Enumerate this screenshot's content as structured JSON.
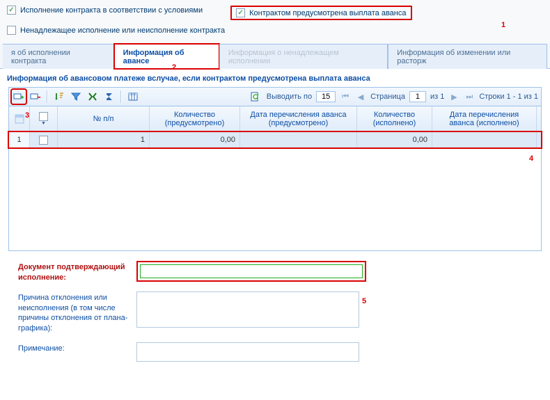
{
  "top": {
    "cb1_label": "Исполнение контракта в соответствии с условиями",
    "cb1_checked": true,
    "cb2_label": "Контрактом предусмотрена выплата аванса",
    "cb2_checked": true,
    "cb3_label": "Ненадлежащее исполнение или неисполнение контракта",
    "cb3_checked": false
  },
  "annotations": {
    "a1": "1",
    "a2": "2",
    "a3": "3",
    "a4": "4",
    "a5": "5"
  },
  "tabs": {
    "t0": "я об исполнении контракта",
    "t1": "Информация об авансе",
    "t2": "Информация о ненадлежащем исполнении",
    "t3": "Информация об изменении или расторж"
  },
  "section_title": "Информация об авансовом платеже вслучае, если контрактом предусмотрена выплата аванса",
  "paging": {
    "show_label": "Выводить по",
    "per_page": "15",
    "page_label": "Страница",
    "current": "1",
    "of": "из 1",
    "rows_text": "Строки 1 - 1 из 1"
  },
  "columns": {
    "c2": "№ п/п",
    "c3": "Количество (предусмотрено)",
    "c4": "Дата перечисления аванса (предусмотрено)",
    "c5": "Количество (исполнено)",
    "c6": "Дата перечисления аванса (исполнено)"
  },
  "row": {
    "idx": "1",
    "no": "1",
    "qty_plan": "0,00",
    "date_plan": "",
    "qty_fact": "0,00",
    "date_fact": ""
  },
  "form": {
    "doc_label": "Документ подтверждающий исполнение:",
    "reason_label": "Причина отклонения или неисполнения (в том числе причины отклонения от плана-графика):",
    "note_label": "Примечание:"
  }
}
